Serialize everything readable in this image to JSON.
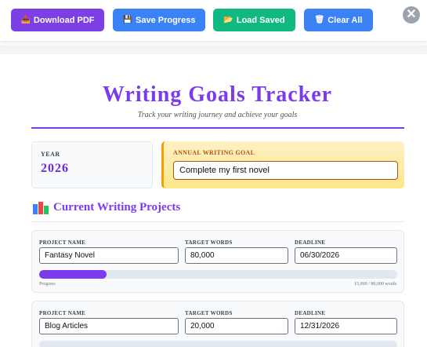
{
  "toolbar": {
    "buttons": [
      {
        "label": "Download PDF",
        "icon": "📥"
      },
      {
        "label": "Save Progress",
        "icon": "💾"
      },
      {
        "label": "Load Saved",
        "icon": "📂"
      },
      {
        "label": "Clear All",
        "icon": "🗑"
      }
    ],
    "close_label": "✕"
  },
  "header": {
    "title": "Writing Goals Tracker",
    "subtitle": "Track your writing journey and achieve your goals"
  },
  "year": {
    "label": "YEAR",
    "value": "2026"
  },
  "goal": {
    "label": "ANNUAL WRITING GOAL",
    "value": "Complete my first novel"
  },
  "section": {
    "title": "Current Writing Projects",
    "icon": "books-icon"
  },
  "labels": {
    "name": "PROJECT NAME",
    "target": "TARGET WORDS",
    "deadline": "DEADLINE",
    "progress": "Progress"
  },
  "projects": [
    {
      "name": "Fantasy Novel",
      "target": "80,000",
      "deadline": "06/30/2026",
      "progress": 0.1875,
      "progress_text": "15,000 / 80,000 words"
    },
    {
      "name": "Blog Articles",
      "target": "20,000",
      "deadline": "12/31/2026"
    }
  ],
  "colors": {
    "accent": "#7c3aed",
    "pdf": "#7b3fe4",
    "save": "#3b82f6",
    "load": "#10b981",
    "clear": "#3b82f6",
    "goal_border": "#f59e0b"
  }
}
